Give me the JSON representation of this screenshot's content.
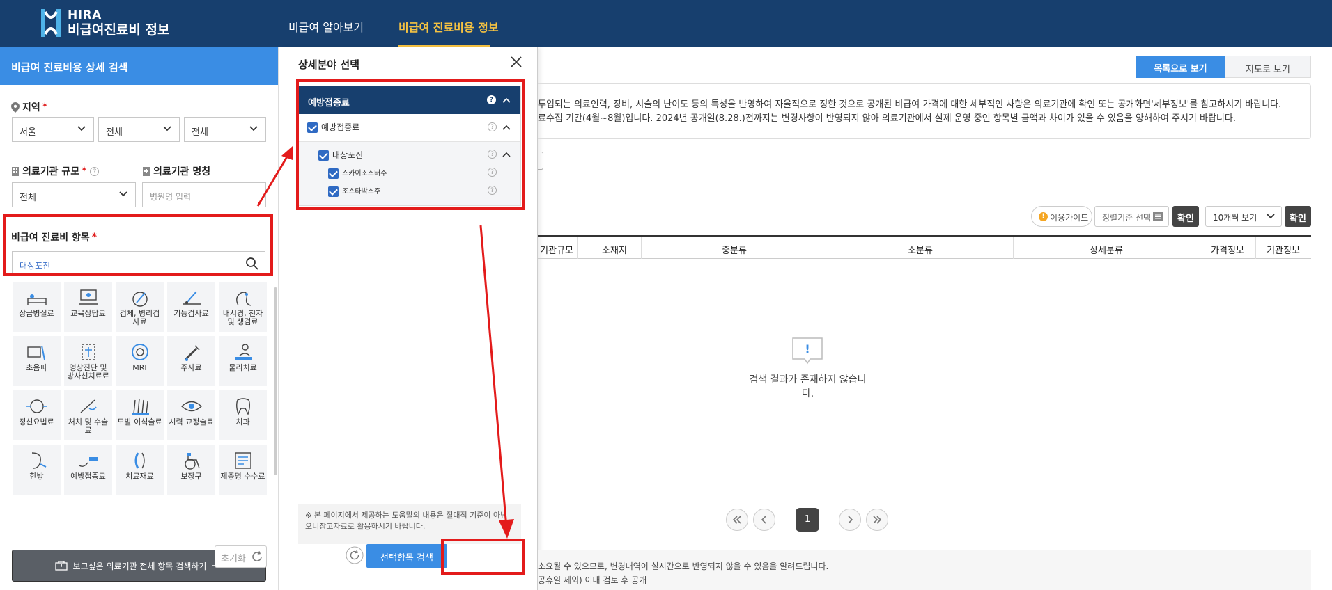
{
  "header": {
    "logo_line1": "HIRA",
    "logo_line2": "비급여진료비 정보",
    "nav": [
      "비급여 알아보기",
      "비급여 진료비용 정보"
    ]
  },
  "left": {
    "title": "비급여 진료비용 상세 검색",
    "region_label": "지역",
    "region_values": [
      "서울",
      "전체",
      "전체"
    ],
    "scale_label": "의료기관 규모",
    "scale_value": "전체",
    "name_label": "의료기관 명칭",
    "name_placeholder": "병원명 입력",
    "item_label": "비급여 진료비 항목",
    "item_value": "대상포진",
    "required_mark": "*",
    "categories": [
      "상급병실료",
      "교육상담료",
      "검체, 병리검사료",
      "기능검사료",
      "내시경, 천자 및 생검료",
      "초음파",
      "영상진단 및 방사선치료료",
      "MRI",
      "주사료",
      "물리치료",
      "정신요법료",
      "처치 및 수술료",
      "모발 이식술료",
      "시력 교정술료",
      "치과",
      "한방",
      "예방접종료",
      "치료재료",
      "보장구",
      "제증명 수수료"
    ],
    "all_search_button": "보고싶은 의료기관 전체 항목 검색하기",
    "reset_button": "초기화"
  },
  "modal": {
    "title": "상세분야 선택",
    "tree_head": "예방접종료",
    "level1": "예방접종료",
    "level2": "대상포진",
    "level3": [
      "스카이조스터주",
      "조스타박스주"
    ],
    "help_mark": "?",
    "note": "※ 본 페이지에서 제공하는 도움말의 내용은 절대적 기준이 아닌 오니참고자료로 활용하시기 바랍니다.",
    "search_button": "선택항목 검색"
  },
  "right": {
    "view_tabs": [
      "목록으로 보기",
      "지도로 보기"
    ],
    "notice_line1": "투입되는 의료인력, 장비, 시술의 난이도 등의 특성을 반영하여 자율적으로 정한 것으로 공개된 비급여 가격에 대한 세부적인 사항은 의료기관에 확인 또는 공개화면'세부정보'를 참고하시기 바랍니다.",
    "notice_line2": "료수집 기간(4월~8월)입니다. 2024년 공개일(8.28.)전까지는 변경사항이 반영되지 않아 의료기관에서 실제 운영 중인 항목별 금액과 차이가 있을 수 있음을 양해하여 주시기 바랍니다.",
    "guide": "이용가이드",
    "sort_placeholder": "정렬기준 선택",
    "confirm": "확인",
    "per_page": "10개씩 보기",
    "columns": [
      "기관규모",
      "소재지",
      "중분류",
      "소분류",
      "상세분류",
      "가격정보",
      "기관정보"
    ],
    "empty_message": "검색 결과가 존재하지 않습니다.",
    "current_page": "1",
    "footer_line1": "소요될 수 있으므로, 변경내역이 실시간으로 반영되지 않을 수 있음을 알려드립니다.",
    "footer_line2": "공휴일 제외) 이내 검토 후 공개"
  },
  "colors": {
    "nav_bg": "#173f6e",
    "accent_blue": "#3a8de4",
    "nav_active": "#f5c242",
    "annotation_red": "#e31b1b"
  }
}
